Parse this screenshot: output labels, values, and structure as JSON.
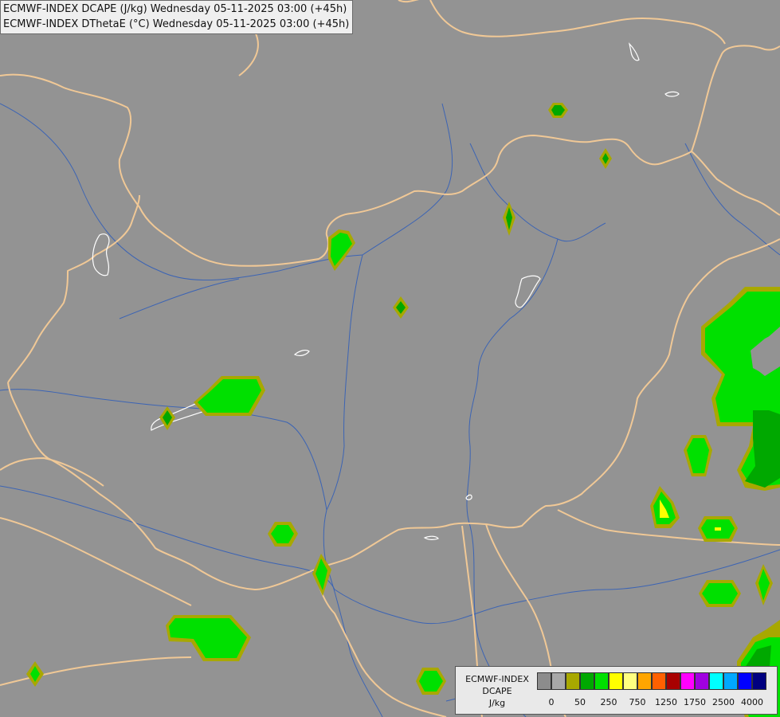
{
  "title": {
    "line1": "ECMWF-INDEX DCAPE (J/kg) Wednesday 05-11-2025 03:00 (+45h)",
    "line2": "ECMWF-INDEX DThetaE (°C) Wednesday 05-11-2025 03:00 (+45h)"
  },
  "legend": {
    "model": "ECMWF-INDEX",
    "parameter": "DCAPE",
    "unit": "J/kg",
    "colors": [
      "#8c8c8c",
      "#a8a8a8",
      "#a8a800",
      "#00a800",
      "#00e000",
      "#ffff00",
      "#ffff80",
      "#ffa500",
      "#ff6000",
      "#a80000",
      "#ff00ff",
      "#a000e0",
      "#00ffff",
      "#00a8ff",
      "#0000ff",
      "#000080"
    ],
    "tick_labels": [
      "0",
      "50",
      "250",
      "750",
      "1250",
      "1750",
      "2500",
      "4000"
    ]
  },
  "colors": {
    "background": "#939393",
    "borders": "#f0c896",
    "rivers": "#3c64b4",
    "lakes": "#ffffff"
  }
}
